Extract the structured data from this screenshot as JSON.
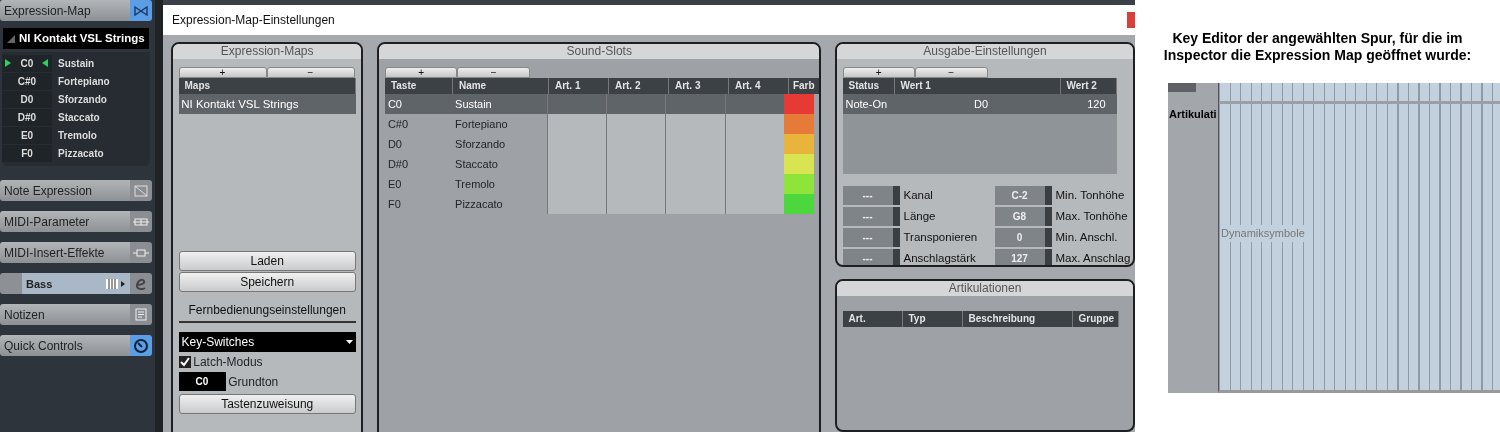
{
  "inspector": {
    "header": {
      "label": "Expression-Map",
      "active": true
    },
    "map_name": "NI Kontakt VSL Strings",
    "slots": [
      {
        "key": "C0",
        "name": "Sustain",
        "selected": true
      },
      {
        "key": "C#0",
        "name": "Fortepiano",
        "selected": false
      },
      {
        "key": "D0",
        "name": "Sforzando",
        "selected": false
      },
      {
        "key": "D#0",
        "name": "Staccato",
        "selected": false
      },
      {
        "key": "E0",
        "name": "Tremolo",
        "selected": false
      },
      {
        "key": "F0",
        "name": "Pizzacato",
        "selected": false
      }
    ],
    "sections": [
      {
        "kind": "section",
        "label": "Note Expression",
        "active": false
      },
      {
        "kind": "section",
        "label": "MIDI-Parameter",
        "active": false
      },
      {
        "kind": "section",
        "label": "MIDI-Insert-Effekte",
        "active": false
      },
      {
        "kind": "track",
        "label": "Bass",
        "active": false
      },
      {
        "kind": "section",
        "label": "Notizen",
        "active": false
      },
      {
        "kind": "section",
        "label": "Quick Controls",
        "active": true
      }
    ]
  },
  "dialog": {
    "title": "Expression-Map-Einstellungen",
    "expression_maps": {
      "title": "Expression-Maps",
      "add": "+",
      "remove": "−",
      "column": "Maps",
      "rows": [
        {
          "name": "NI Kontakt VSL Strings",
          "selected": true
        }
      ],
      "buttons": [
        "Laden",
        "Speichern"
      ],
      "remote_title": "Fernbedienungseinstellungen",
      "mode": "Key-Switches",
      "latch": {
        "label": "Latch-Modus",
        "checked": true
      },
      "root": {
        "value": "C0",
        "label": "Grundton"
      },
      "assign_button": "Tastenzuweisung"
    },
    "sound_slots": {
      "title": "Sound-Slots",
      "add": "+",
      "remove": "−",
      "columns": [
        "Taste",
        "Name",
        "Art. 1",
        "Art. 2",
        "Art. 3",
        "Art. 4",
        "Farb"
      ],
      "rows": [
        {
          "key": "C0",
          "name": "Sustain",
          "color": "#e83a34",
          "selected": true
        },
        {
          "key": "C#0",
          "name": "Fortepiano",
          "color": "#e67a38",
          "selected": false
        },
        {
          "key": "D0",
          "name": "Sforzando",
          "color": "#e8b43c",
          "selected": false
        },
        {
          "key": "D#0",
          "name": "Staccato",
          "color": "#d8e450",
          "selected": false
        },
        {
          "key": "E0",
          "name": "Tremolo",
          "color": "#8ee438",
          "selected": false
        },
        {
          "key": "F0",
          "name": "Pizzacato",
          "color": "#4cd83c",
          "selected": false
        }
      ]
    },
    "output": {
      "title": "Ausgabe-Einstellungen",
      "add": "+",
      "remove": "−",
      "columns": [
        "Status",
        "Wert 1",
        "Wert 2"
      ],
      "rows": [
        {
          "status": "Note-On",
          "value_1": "D0",
          "value_2": "120",
          "selected": true
        }
      ],
      "params_left": [
        {
          "value": "---",
          "label": "Kanal"
        },
        {
          "value": "---",
          "label": "Länge"
        },
        {
          "value": "---",
          "label": "Transponieren"
        },
        {
          "value": "---",
          "label": "Anschlagstärk"
        }
      ],
      "params_right": [
        {
          "value": "C-2",
          "label": "Min. Tonhöhe"
        },
        {
          "value": "G8",
          "label": "Max. Tonhöhe"
        },
        {
          "value": "0",
          "label": "Min. Anschl."
        },
        {
          "value": "127",
          "label": "Max. Anschlag"
        }
      ]
    },
    "articulations": {
      "title": "Artikulationen",
      "columns": [
        "Art.",
        "Typ",
        "Beschreibung",
        "Gruppe"
      ]
    }
  },
  "annotation": {
    "caption_lines": [
      "Key Editor der angewählten Spur, für die im",
      "Inspector die Expression Map geöffnet wurde:"
    ],
    "editor": {
      "lane_label": "Artikulati",
      "lane_text": "Dynamiksymbole"
    }
  }
}
